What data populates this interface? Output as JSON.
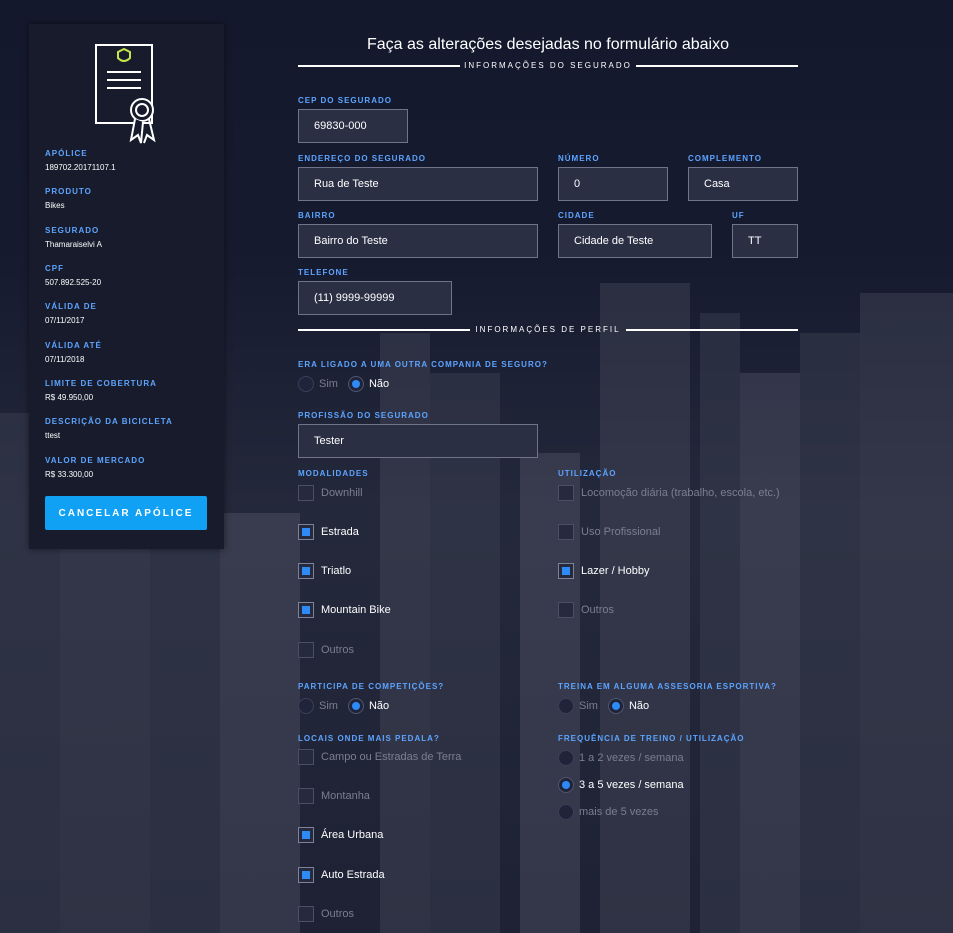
{
  "sidebar": {
    "fields": [
      {
        "label": "APÓLICE",
        "value": "189702.20171107.1"
      },
      {
        "label": "PRODUTO",
        "value": "Bikes"
      },
      {
        "label": "SEGURADO",
        "value": "Thamaraiselvi A"
      },
      {
        "label": "CPF",
        "value": "507.892.525-20"
      },
      {
        "label": "VÁLIDA DE",
        "value": "07/11/2017"
      },
      {
        "label": "VÁLIDA ATÉ",
        "value": "07/11/2018"
      },
      {
        "label": "LIMITE DE COBERTURA",
        "value": "R$ 49.950,00"
      },
      {
        "label": "DESCRIÇÃO DA BICICLETA",
        "value": "ttest"
      },
      {
        "label": "VALOR DE MERCADO",
        "value": "R$ 33.300,00"
      }
    ],
    "cancel_label": "CANCELAR APÓLICE"
  },
  "form": {
    "title": "Faça as alterações desejadas no formulário abaixo",
    "section_insured": "INFORMAÇÕES DO SEGURADO",
    "section_profile": "INFORMAÇÕES DE PERFIL",
    "cep": {
      "label": "CEP DO SEGURADO",
      "value": "69830-000"
    },
    "endereco": {
      "label": "ENDEREÇO DO SEGURADO",
      "value": "Rua de Teste"
    },
    "numero": {
      "label": "NÚMERO",
      "value": "0"
    },
    "complemento": {
      "label": "COMPLEMENTO",
      "value": "Casa"
    },
    "bairro": {
      "label": "BAIRRO",
      "value": "Bairro do Teste"
    },
    "cidade": {
      "label": "CIDADE",
      "value": "Cidade de Teste"
    },
    "uf": {
      "label": "UF",
      "value": "TT"
    },
    "telefone": {
      "label": "TELEFONE",
      "value": "(11) 9999-99999"
    },
    "other_company": {
      "label": "ERA LIGADO A UMA OUTRA COMPANIA DE SEGURO?",
      "yes": "Sim",
      "no": "Não",
      "selected": "no"
    },
    "profissao": {
      "label": "PROFISSÃO DO SEGURADO",
      "value": "Tester"
    },
    "modalidades": {
      "label": "MODALIDADES",
      "options": [
        {
          "text": "Downhill",
          "checked": false
        },
        {
          "text": "Estrada",
          "checked": true
        },
        {
          "text": "Triatlo",
          "checked": true
        },
        {
          "text": "Mountain Bike",
          "checked": true
        },
        {
          "text": "Outros",
          "checked": false
        }
      ]
    },
    "utilizacao": {
      "label": "UTILIZAÇÃO",
      "options": [
        {
          "text": "Locomoção diária (trabalho, escola, etc.)",
          "checked": false
        },
        {
          "text": "Uso Profissional",
          "checked": false
        },
        {
          "text": "Lazer / Hobby",
          "checked": true
        },
        {
          "text": "Outros",
          "checked": false
        }
      ]
    },
    "competicoes": {
      "label": "PARTICIPA DE COMPETIÇÕES?",
      "yes": "Sim",
      "no": "Não",
      "selected": "no"
    },
    "assessoria": {
      "label": "TREINA EM ALGUMA ASSESORIA ESPORTIVA?",
      "yes": "Sim",
      "no": "Não",
      "selected": "no"
    },
    "locais": {
      "label": "LOCAIS ONDE MAIS PEDALA?",
      "options": [
        {
          "text": "Campo ou Estradas de Terra",
          "checked": false
        },
        {
          "text": "Montanha",
          "checked": false
        },
        {
          "text": "Área Urbana",
          "checked": true
        },
        {
          "text": "Auto Estrada",
          "checked": true
        },
        {
          "text": "Outros",
          "checked": false
        }
      ]
    },
    "frequencia": {
      "label": "FREQUÊNCIA DE TREINO / UTILIZAÇÃO",
      "options": [
        {
          "text": "1 a 2 vezes / semana",
          "checked": false
        },
        {
          "text": "3 a 5 vezes / semana",
          "checked": true
        },
        {
          "text": "mais de 5 vezes",
          "checked": false
        }
      ]
    }
  }
}
